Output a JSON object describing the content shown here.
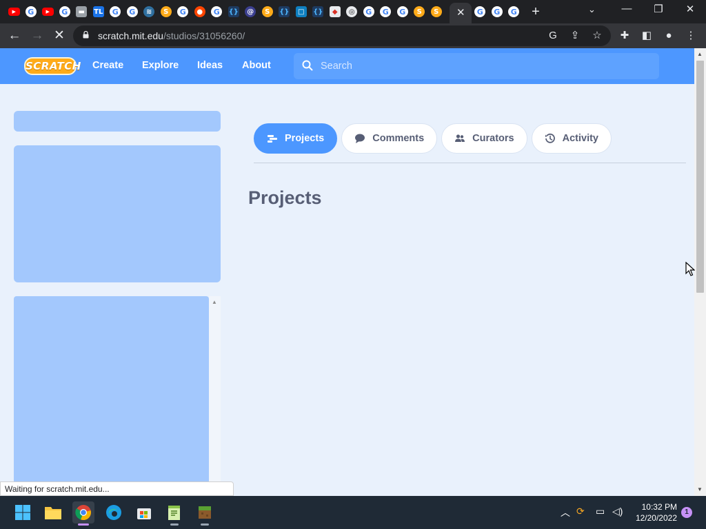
{
  "browser": {
    "tab_favicons": [
      "youtube",
      "google",
      "youtube",
      "google",
      "monitor",
      "tl",
      "google",
      "google",
      "network",
      "scratch-cat",
      "google",
      "reddit",
      "google",
      "code-braces",
      "at-sign",
      "scratch-cat",
      "code-braces",
      "chat",
      "code-braces",
      "roblox",
      "chrome",
      "google",
      "google",
      "google",
      "scratch-cat",
      "scratch-cat"
    ],
    "active_tab_close": "✕",
    "new_tab": "+",
    "url_host": "scratch.mit.edu",
    "url_path": "/studios/31056260/",
    "status_text": "Waiting for scratch.mit.edu..."
  },
  "scratch": {
    "logo_text": "SCRATCH",
    "nav": [
      "Create",
      "Explore",
      "Ideas",
      "About"
    ],
    "search_placeholder": "Search",
    "tabs": [
      {
        "label": "Projects",
        "icon": "projects-icon",
        "active": true
      },
      {
        "label": "Comments",
        "icon": "comment-icon",
        "active": false
      },
      {
        "label": "Curators",
        "icon": "curators-icon",
        "active": false
      },
      {
        "label": "Activity",
        "icon": "history-icon",
        "active": false
      }
    ],
    "section_title": "Projects"
  },
  "taskbar": {
    "apps": [
      "start",
      "file-explorer",
      "chrome",
      "edge",
      "microsoft-store",
      "notepad-plus",
      "minecraft"
    ],
    "time": "10:32 PM",
    "date": "12/20/2022",
    "notifications": "1"
  },
  "colors": {
    "scratch_blue": "#4d97ff",
    "page_bg": "#e9f1fc",
    "skeleton": "#a3c8fd",
    "text_gray": "#575e75"
  }
}
